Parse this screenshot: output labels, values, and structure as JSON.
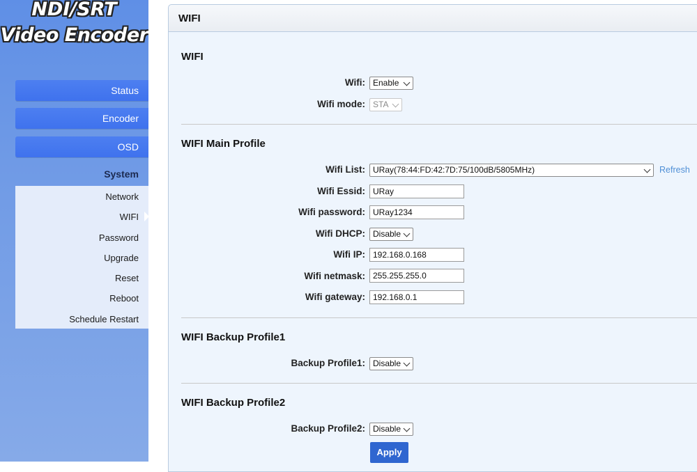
{
  "brand": {
    "line1": "NDI/SRT",
    "line2": "Video Encoder"
  },
  "nav": {
    "status": "Status",
    "encoder": "Encoder",
    "osd": "OSD",
    "system": "System",
    "sub": [
      "Network",
      "WIFI",
      "Password",
      "Upgrade",
      "Reset",
      "Reboot",
      "Schedule Restart"
    ],
    "active_sub": "WIFI"
  },
  "panel": {
    "title": "WIFI"
  },
  "wifi": {
    "section": "WIFI",
    "wifi_label": "Wifi:",
    "wifi_value": "Enable",
    "mode_label": "Wifi mode:",
    "mode_value": "STA"
  },
  "main_profile": {
    "section": "WIFI Main Profile",
    "list_label": "Wifi List:",
    "list_value": "URay(78:44:FD:42:7D:75/100dB/5805MHz)",
    "refresh": "Refresh",
    "essid_label": "Wifi Essid:",
    "essid_value": "URay",
    "password_label": "Wifi password:",
    "password_value": "URay1234",
    "dhcp_label": "Wifi DHCP:",
    "dhcp_value": "Disable",
    "ip_label": "Wifi IP:",
    "ip_value": "192.168.0.168",
    "netmask_label": "Wifi netmask:",
    "netmask_value": "255.255.255.0",
    "gateway_label": "Wifi gateway:",
    "gateway_value": "192.168.0.1"
  },
  "backup1": {
    "section": "WIFI Backup Profile1",
    "label": "Backup Profile1:",
    "value": "Disable"
  },
  "backup2": {
    "section": "WIFI Backup Profile2",
    "label": "Backup Profile2:",
    "value": "Disable"
  },
  "apply": "Apply",
  "colors": {
    "nav_button": "#4d7ff0",
    "sidebar_bg": "#6f9ae6",
    "panel_bg": "#eef5fd",
    "apply_bg": "#2f66d0",
    "refresh_link": "#4f8fd6"
  }
}
